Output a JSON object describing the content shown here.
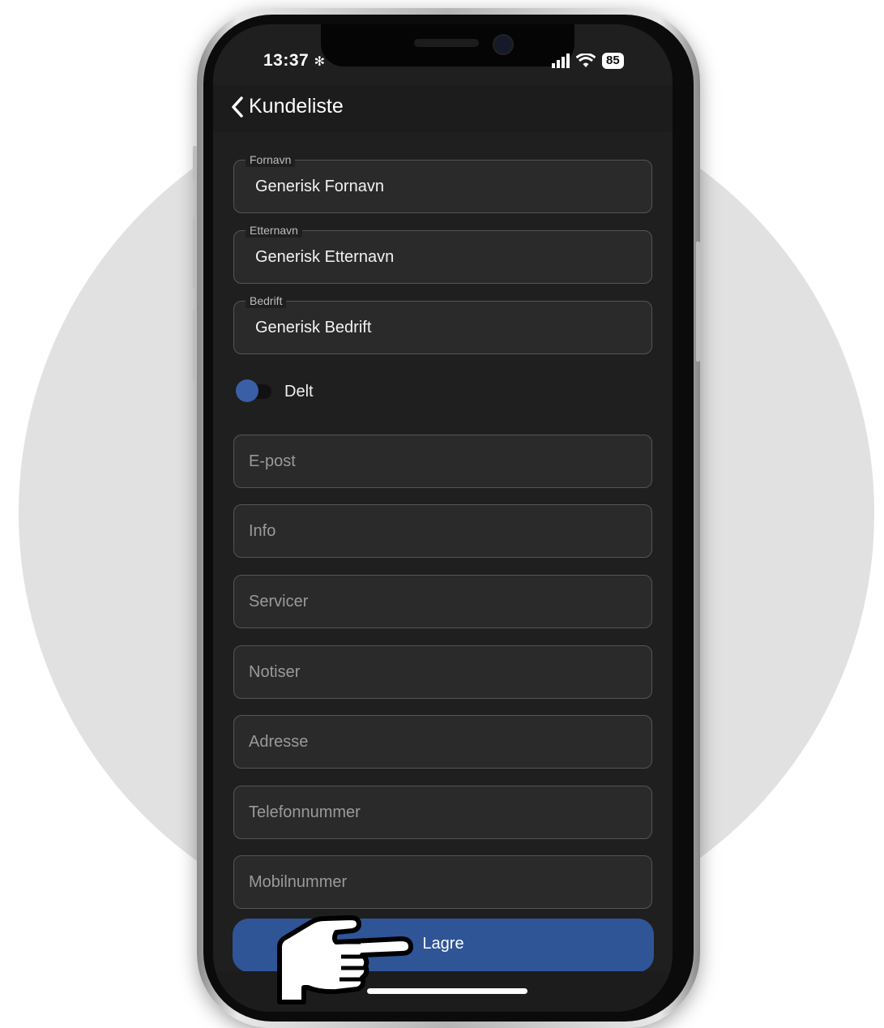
{
  "status_bar": {
    "time": "13:37",
    "battery": "85"
  },
  "header": {
    "back_label": "Kundeliste"
  },
  "form": {
    "first_name": {
      "label": "Fornavn",
      "value": "Generisk Fornavn"
    },
    "last_name": {
      "label": "Etternavn",
      "value": "Generisk Etternavn"
    },
    "company": {
      "label": "Bedrift",
      "value": "Generisk Bedrift"
    },
    "shared_toggle": {
      "label": "Delt",
      "on": false
    },
    "email": {
      "placeholder": "E-post"
    },
    "info": {
      "placeholder": "Info"
    },
    "services": {
      "placeholder": "Servicer"
    },
    "notes": {
      "placeholder": "Notiser"
    },
    "address": {
      "placeholder": "Adresse"
    },
    "phone": {
      "placeholder": "Telefonnummer"
    },
    "mobile": {
      "placeholder": "Mobilnummer"
    }
  },
  "actions": {
    "save_label": "Lagre"
  },
  "colors": {
    "background": "#1f1f1f",
    "accent": "#2f5597",
    "toggle": "#3a5fa6"
  },
  "icons": [
    "chevron-left-icon",
    "gear-icon",
    "signal-icon",
    "wifi-icon",
    "battery-icon",
    "pointing-hand-icon"
  ]
}
